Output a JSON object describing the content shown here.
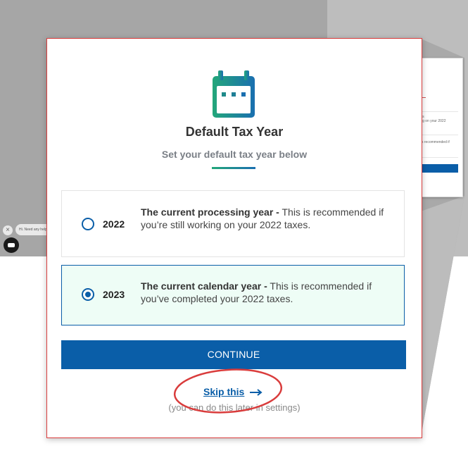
{
  "modal": {
    "title": "Default Tax Year",
    "subtitle": "Set your default tax year below",
    "options": [
      {
        "year": "2022",
        "heading": "The current processing year -",
        "description": " This is recommended if you’re still working on your 2022 taxes.",
        "selected": false
      },
      {
        "year": "2023",
        "heading": "The current calendar year -",
        "description": " This is recommended if you’ve completed your 2022 taxes.",
        "selected": true
      }
    ],
    "continue_label": "CONTINUE",
    "skip_label": "Skip this",
    "skip_hint": "(you can do this later in settings)"
  },
  "chat": {
    "bubble_text": "Hi. Need any help?"
  },
  "colors": {
    "primary": "#0a5ea8",
    "selected_bg": "#eefdf6",
    "icon_gradient_start": "#23a77a",
    "icon_gradient_end": "#1a6fb0",
    "annotation": "#d93c3c"
  }
}
